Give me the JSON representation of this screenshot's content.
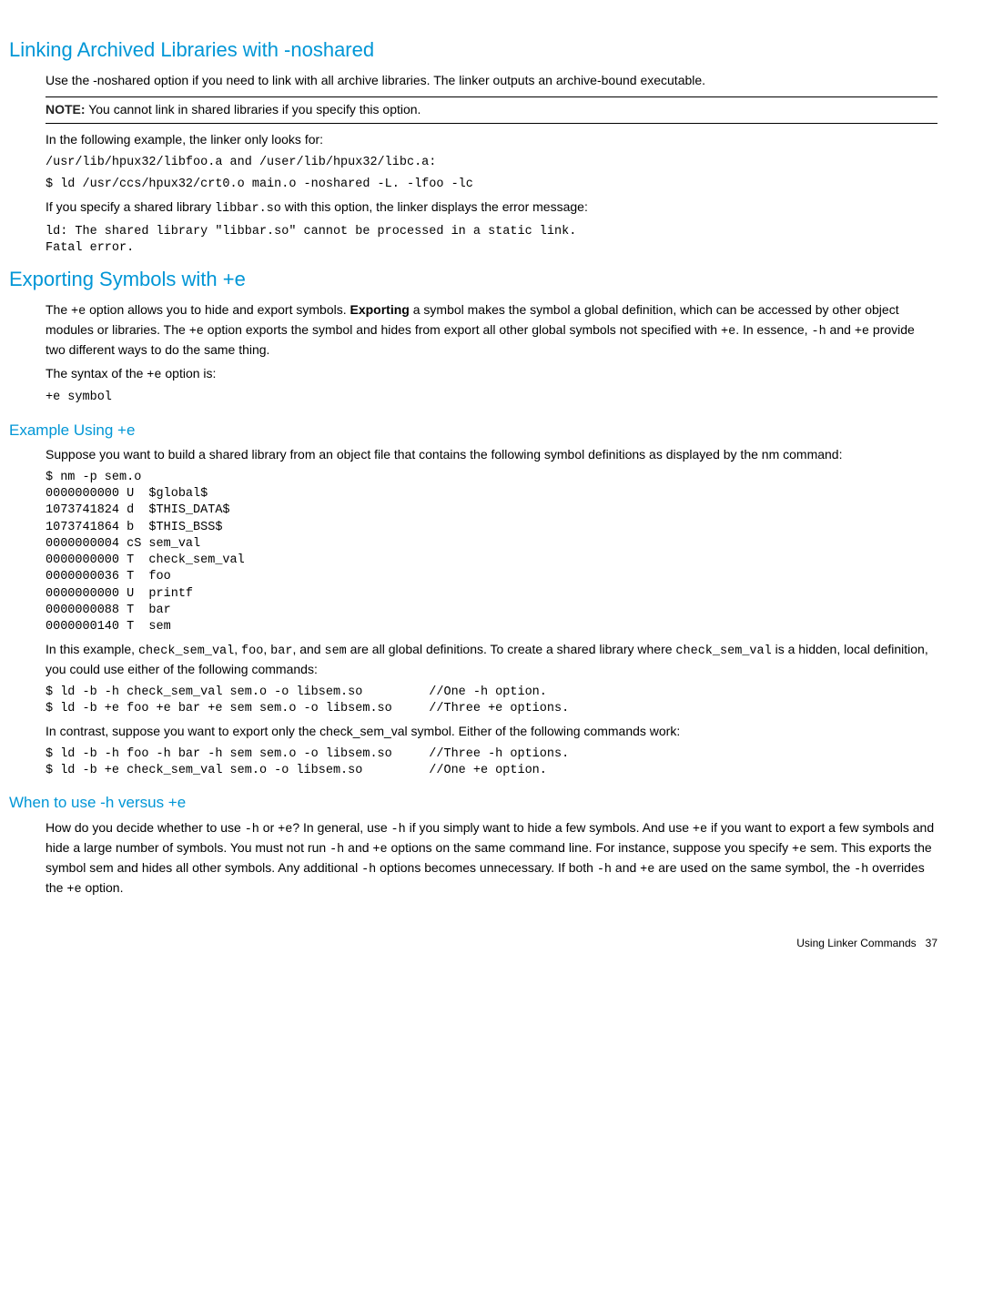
{
  "s1": {
    "title": "Linking Archived Libraries with -noshared",
    "p1": "Use the -noshared option if you need to link with all archive libraries. The linker outputs an archive-bound executable.",
    "note_label": "NOTE:",
    "note_text": "   You cannot link in shared libraries if you specify this option.",
    "p2": "In the following example, the linker only looks for:",
    "code1": "/usr/lib/hpux32/libfoo.a and /user/lib/hpux32/libc.a:",
    "code2": "$ ld /usr/ccs/hpux32/crt0.o main.o -noshared -L. -lfoo -lc",
    "p3a": "If you specify a shared library  ",
    "p3code": "libbar.so",
    "p3b": " with this option, the linker displays the error message:",
    "code3": "ld: The shared library \"libbar.so\" cannot be processed in a static link.\nFatal error."
  },
  "s2": {
    "title": "Exporting Symbols with +e",
    "p1a": "The ",
    "p1c1": "+e",
    "p1b": " option allows you to hide and export symbols. ",
    "p1bold": "Exporting",
    "p1c": " a symbol makes the symbol a global definition, which can be accessed by other object modules or libraries. The ",
    "p1c2": "+e",
    "p1d": " option exports the symbol and hides from export all other global symbols not specified with ",
    "p1c3": "+e",
    "p1e": ". In essence, ",
    "p1c4": "-h",
    "p1f": " and ",
    "p1c5": "+e",
    "p1g": " provide two different ways to do the same thing.",
    "p2a": "The syntax of the ",
    "p2c": "+e",
    "p2b": " option is:",
    "code1": "+e symbol"
  },
  "s3": {
    "title": "Example Using +e",
    "p1": "Suppose you want to build a shared library from an object file that contains the following symbol definitions as displayed by the nm command:",
    "code1": "$ nm -p sem.o\n0000000000 U  $global$\n1073741824 d  $THIS_DATA$\n1073741864 b  $THIS_BSS$\n0000000004 cS sem_val\n0000000000 T  check_sem_val\n0000000036 T  foo\n0000000000 U  printf\n0000000088 T  bar\n0000000140 T  sem",
    "p2a": "In this example, ",
    "p2c1": "check_sem_val",
    "p2b": ", ",
    "p2c2": "foo",
    "p2c": ", ",
    "p2c3": "bar",
    "p2d": ", and ",
    "p2c4": "sem",
    "p2e": " are all global definitions. To create a shared library where ",
    "p2c5": "check_sem_val",
    "p2f": " is a hidden, local definition, you could use either of the following commands:",
    "code2": "$ ld -b -h check_sem_val sem.o -o libsem.so         //One -h option.\n$ ld -b +e foo +e bar +e sem sem.o -o libsem.so     //Three +e options.",
    "p3": "In contrast, suppose you want to export only the check_sem_val symbol. Either of the following commands work:",
    "code3": "$ ld -b -h foo -h bar -h sem sem.o -o libsem.so     //Three -h options.\n$ ld -b +e check_sem_val sem.o -o libsem.so         //One +e option."
  },
  "s4": {
    "title": "When to use -h versus +e",
    "p1a": "How do you decide whether to use ",
    "p1c1": "-h",
    "p1b": " or ",
    "p1c2": "+e",
    "p1c": "? In general, use ",
    "p1c3": "-h",
    "p1d": " if you simply want to hide a few symbols. And use ",
    "p1c4": "+e",
    "p1e": " if you want to export a few symbols and hide a large number of symbols. You must not run ",
    "p1c5": "-h",
    "p1f": " and ",
    "p1c6": "+e",
    "p1g": " options on the same command line. For instance, suppose you specify ",
    "p1c7": "+e",
    "p1h": " sem. This exports the symbol sem and hides all other symbols. Any additional ",
    "p1c8": "-h",
    "p1i": " options becomes unnecessary. If both ",
    "p1c9": "-h",
    "p1j": " and ",
    "p1c10": "+e",
    "p1k": " are used on the same symbol, the ",
    "p1c11": "-h",
    "p1l": " overrides the ",
    "p1c12": "+e",
    "p1m": " option."
  },
  "footer": {
    "text": "Using Linker Commands",
    "page": "37"
  }
}
